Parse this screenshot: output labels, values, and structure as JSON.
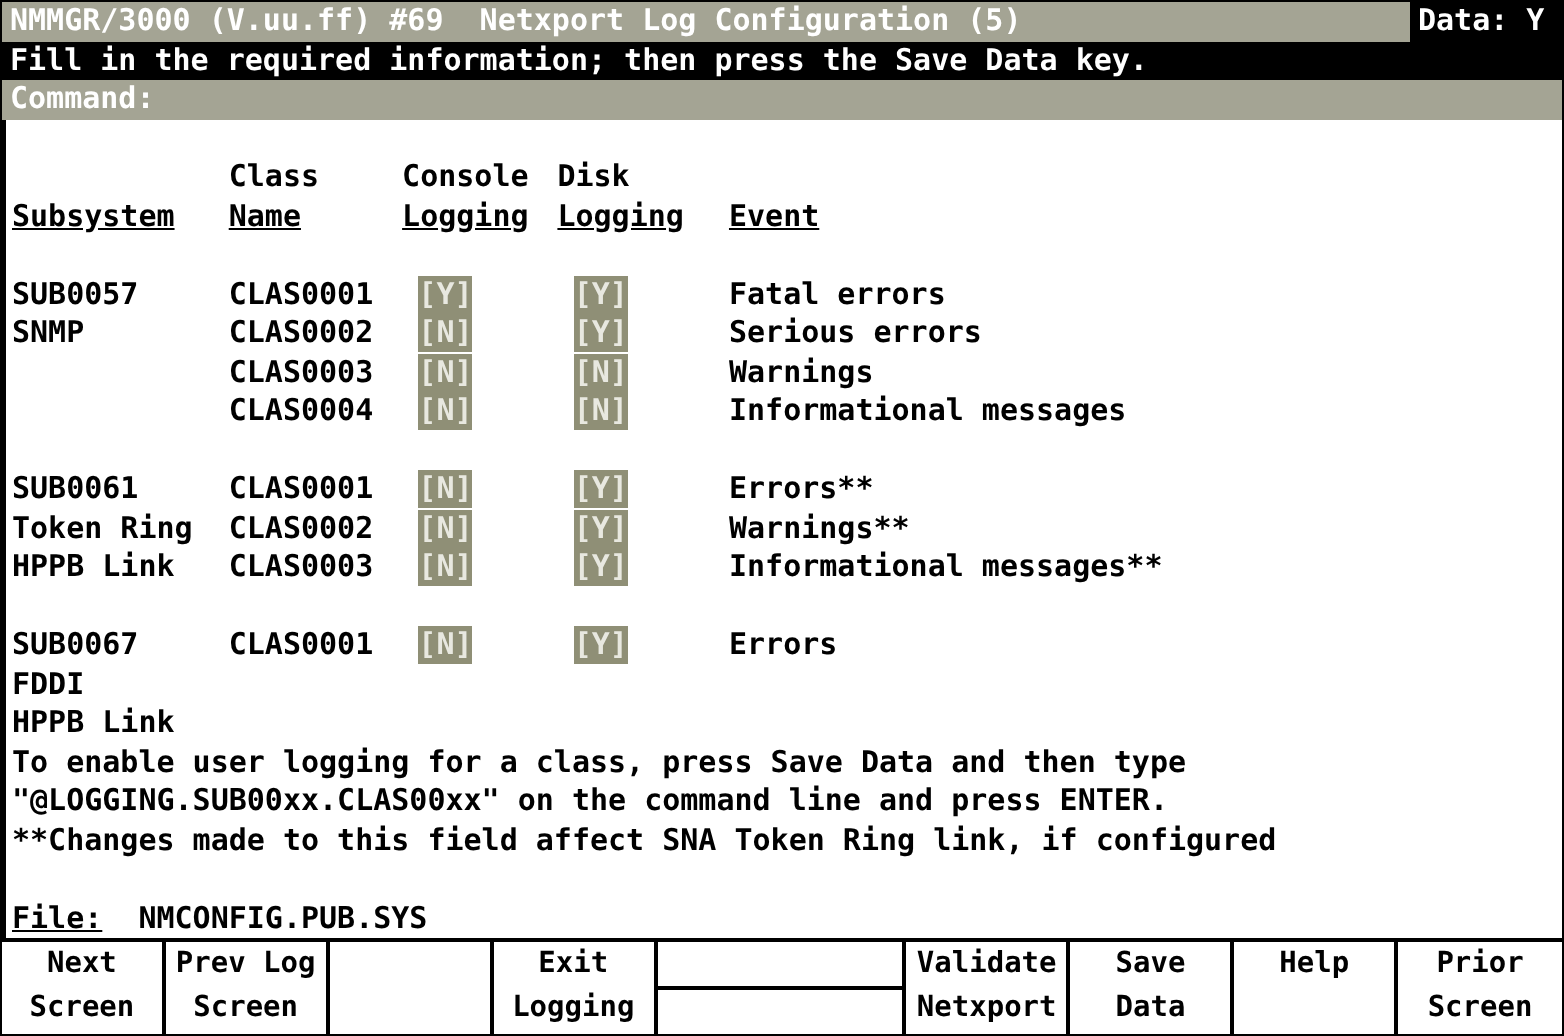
{
  "header": {
    "title": "NMMGR/3000 (V.uu.ff) #69  Netxport Log Configuration (5)",
    "data_flag": "Data: Y",
    "message": "Fill in the required information; then press the Save Data key.",
    "command_label": "Command:"
  },
  "columns": [
    {
      "label": "Subsystem"
    },
    {
      "top": "Class",
      "label": "Name"
    },
    {
      "top": "Console",
      "label": "Logging"
    },
    {
      "top": "Disk",
      "label": "Logging"
    },
    {
      "label": "Event"
    }
  ],
  "groups": [
    {
      "names": [
        "SUB0057",
        "SNMP"
      ],
      "classes": [
        {
          "class_name": "CLAS0001",
          "console": "[Y]",
          "disk": "[Y]",
          "event": "Fatal errors"
        },
        {
          "class_name": "CLAS0002",
          "console": "[N]",
          "disk": "[Y]",
          "event": "Serious errors"
        },
        {
          "class_name": "CLAS0003",
          "console": "[N]",
          "disk": "[N]",
          "event": "Warnings"
        },
        {
          "class_name": "CLAS0004",
          "console": "[N]",
          "disk": "[N]",
          "event": "Informational messages"
        }
      ]
    },
    {
      "names": [
        "SUB0061",
        "Token Ring",
        "HPPB Link"
      ],
      "classes": [
        {
          "class_name": "CLAS0001",
          "console": "[N]",
          "disk": "[Y]",
          "event": "Errors**"
        },
        {
          "class_name": "CLAS0002",
          "console": "[N]",
          "disk": "[Y]",
          "event": "Warnings**"
        },
        {
          "class_name": "CLAS0003",
          "console": "[N]",
          "disk": "[Y]",
          "event": "Informational messages**"
        }
      ]
    },
    {
      "names": [
        "SUB0067",
        "FDDI",
        "HPPB Link"
      ],
      "classes": [
        {
          "class_name": "CLAS0001",
          "console": "[N]",
          "disk": "[Y]",
          "event": "Errors"
        }
      ]
    }
  ],
  "notes": [
    "To enable user logging for a class, press Save Data and then type",
    "\"@LOGGING.SUB00xx.CLAS00xx\" on the command line and press ENTER.",
    "**Changes made to this field affect SNA Token Ring link, if configured"
  ],
  "file": {
    "label": "File:",
    "value": "NMCONFIG.PUB.SYS"
  },
  "function_keys": [
    {
      "kind": "key",
      "lines": [
        "Next",
        "Screen"
      ]
    },
    {
      "kind": "key",
      "lines": [
        "Prev Log",
        "Screen"
      ]
    },
    {
      "kind": "blank"
    },
    {
      "kind": "key",
      "lines": [
        "Exit",
        "Logging"
      ]
    },
    {
      "kind": "divided"
    },
    {
      "kind": "key",
      "lines": [
        "Validate",
        "Netxport"
      ]
    },
    {
      "kind": "key",
      "lines": [
        "Save",
        "Data"
      ]
    },
    {
      "kind": "key",
      "lines": [
        "Help"
      ]
    },
    {
      "kind": "key",
      "lines": [
        "Prior",
        "Screen"
      ]
    }
  ]
}
